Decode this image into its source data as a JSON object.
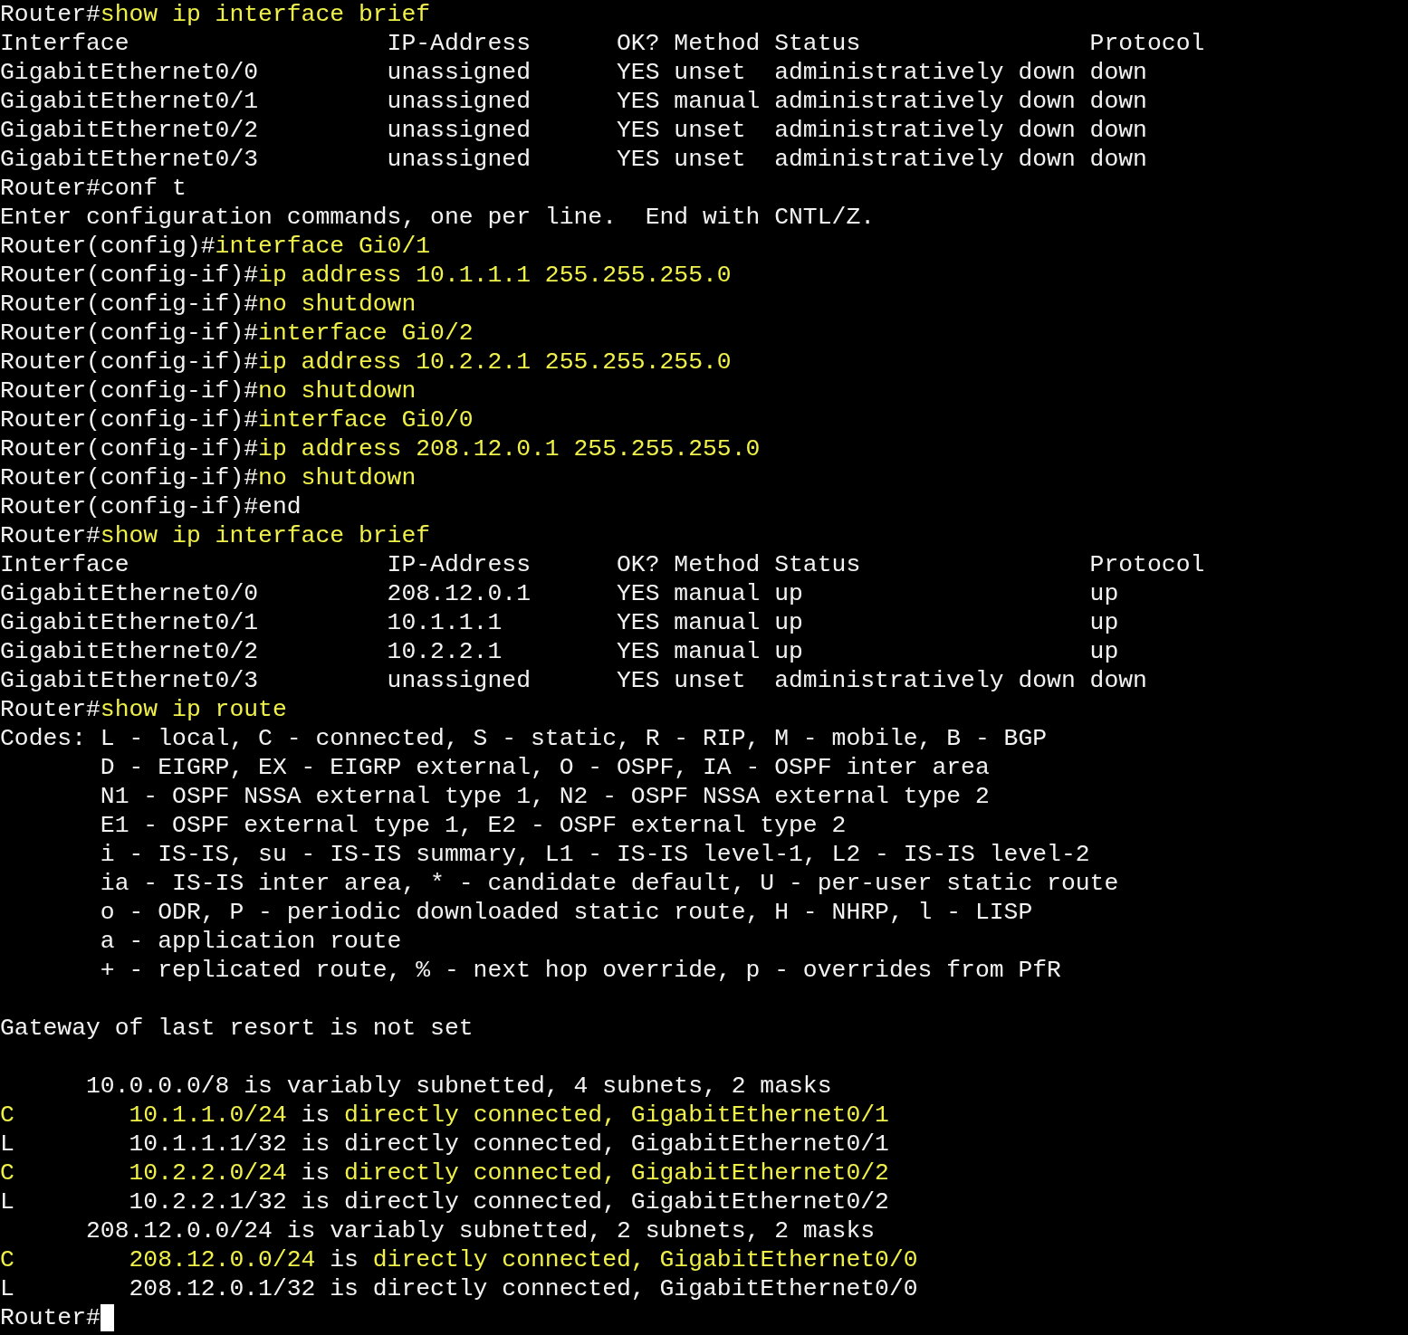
{
  "terminal": {
    "lines": [
      {
        "segments": [
          {
            "text": "Router#",
            "kind": "plain"
          },
          {
            "text": "show ip interface brief",
            "kind": "input"
          }
        ]
      },
      {
        "segments": [
          {
            "text": "Interface                  IP-Address      OK? Method Status                Protocol",
            "kind": "plain"
          }
        ]
      },
      {
        "segments": [
          {
            "text": "GigabitEthernet0/0         unassigned      YES unset  administratively down down",
            "kind": "plain"
          }
        ]
      },
      {
        "segments": [
          {
            "text": "GigabitEthernet0/1         unassigned      YES manual administratively down down",
            "kind": "plain"
          }
        ]
      },
      {
        "segments": [
          {
            "text": "GigabitEthernet0/2         unassigned      YES unset  administratively down down",
            "kind": "plain"
          }
        ]
      },
      {
        "segments": [
          {
            "text": "GigabitEthernet0/3         unassigned      YES unset  administratively down down",
            "kind": "plain"
          }
        ]
      },
      {
        "segments": [
          {
            "text": "Router#conf t",
            "kind": "plain"
          }
        ]
      },
      {
        "segments": [
          {
            "text": "Enter configuration commands, one per line.  End with CNTL/Z.",
            "kind": "plain"
          }
        ]
      },
      {
        "segments": [
          {
            "text": "Router(config)#",
            "kind": "plain"
          },
          {
            "text": "interface Gi0/1",
            "kind": "input"
          }
        ]
      },
      {
        "segments": [
          {
            "text": "Router(config-if)#",
            "kind": "plain"
          },
          {
            "text": "ip address 10.1.1.1 255.255.255.0",
            "kind": "input"
          }
        ]
      },
      {
        "segments": [
          {
            "text": "Router(config-if)#",
            "kind": "plain"
          },
          {
            "text": "no shutdown",
            "kind": "input"
          }
        ]
      },
      {
        "segments": [
          {
            "text": "Router(config-if)#",
            "kind": "plain"
          },
          {
            "text": "interface Gi0/2",
            "kind": "input"
          }
        ]
      },
      {
        "segments": [
          {
            "text": "Router(config-if)#",
            "kind": "plain"
          },
          {
            "text": "ip address 10.2.2.1 255.255.255.0",
            "kind": "input"
          }
        ]
      },
      {
        "segments": [
          {
            "text": "Router(config-if)#",
            "kind": "plain"
          },
          {
            "text": "no shutdown",
            "kind": "input"
          }
        ]
      },
      {
        "segments": [
          {
            "text": "Router(config-if)#",
            "kind": "plain"
          },
          {
            "text": "interface Gi0/0",
            "kind": "input"
          }
        ]
      },
      {
        "segments": [
          {
            "text": "Router(config-if)#",
            "kind": "plain"
          },
          {
            "text": "ip address 208.12.0.1 255.255.255.0",
            "kind": "input"
          }
        ]
      },
      {
        "segments": [
          {
            "text": "Router(config-if)#",
            "kind": "plain"
          },
          {
            "text": "no shutdown",
            "kind": "input"
          }
        ]
      },
      {
        "segments": [
          {
            "text": "Router(config-if)#end",
            "kind": "plain"
          }
        ]
      },
      {
        "segments": [
          {
            "text": "Router#",
            "kind": "plain"
          },
          {
            "text": "show ip interface brief",
            "kind": "input"
          }
        ]
      },
      {
        "segments": [
          {
            "text": "Interface                  IP-Address      OK? Method Status                Protocol",
            "kind": "plain"
          }
        ]
      },
      {
        "segments": [
          {
            "text": "GigabitEthernet0/0         208.12.0.1      YES manual up                    up",
            "kind": "plain"
          }
        ]
      },
      {
        "segments": [
          {
            "text": "GigabitEthernet0/1         10.1.1.1        YES manual up                    up",
            "kind": "plain"
          }
        ]
      },
      {
        "segments": [
          {
            "text": "GigabitEthernet0/2         10.2.2.1        YES manual up                    up",
            "kind": "plain"
          }
        ]
      },
      {
        "segments": [
          {
            "text": "GigabitEthernet0/3         unassigned      YES unset  administratively down down",
            "kind": "plain"
          }
        ]
      },
      {
        "segments": [
          {
            "text": "Router#",
            "kind": "plain"
          },
          {
            "text": "show ip route",
            "kind": "input"
          }
        ]
      },
      {
        "segments": [
          {
            "text": "Codes: L - local, C - connected, S - static, R - RIP, M - mobile, B - BGP",
            "kind": "plain"
          }
        ]
      },
      {
        "segments": [
          {
            "text": "       D - EIGRP, EX - EIGRP external, O - OSPF, IA - OSPF inter area",
            "kind": "plain"
          }
        ]
      },
      {
        "segments": [
          {
            "text": "       N1 - OSPF NSSA external type 1, N2 - OSPF NSSA external type 2",
            "kind": "plain"
          }
        ]
      },
      {
        "segments": [
          {
            "text": "       E1 - OSPF external type 1, E2 - OSPF external type 2",
            "kind": "plain"
          }
        ]
      },
      {
        "segments": [
          {
            "text": "       i - IS-IS, su - IS-IS summary, L1 - IS-IS level-1, L2 - IS-IS level-2",
            "kind": "plain"
          }
        ]
      },
      {
        "segments": [
          {
            "text": "       ia - IS-IS inter area, * - candidate default, U - per-user static route",
            "kind": "plain"
          }
        ]
      },
      {
        "segments": [
          {
            "text": "       o - ODR, P - periodic downloaded static route, H - NHRP, l - LISP",
            "kind": "plain"
          }
        ]
      },
      {
        "segments": [
          {
            "text": "       a - application route",
            "kind": "plain"
          }
        ]
      },
      {
        "segments": [
          {
            "text": "       + - replicated route, % - next hop override, p - overrides from PfR",
            "kind": "plain"
          }
        ],
        "blank_line_after": true
      },
      {
        "segments": [
          {
            "text": "Gateway of last resort is not set",
            "kind": "plain"
          }
        ],
        "blank_line_after": true
      },
      {
        "segments": [
          {
            "text": "      10.0.0.0/8 is variably subnetted, 4 subnets, 2 masks",
            "kind": "plain"
          }
        ]
      },
      {
        "segments": [
          {
            "text": "C        10.1.1.0/24",
            "kind": "input"
          },
          {
            "text": " is ",
            "kind": "plain"
          },
          {
            "text": "directly connected, GigabitEthernet0/1",
            "kind": "input"
          }
        ]
      },
      {
        "segments": [
          {
            "text": "L        10.1.1.1/32 is directly connected, GigabitEthernet0/1",
            "kind": "plain"
          }
        ]
      },
      {
        "segments": [
          {
            "text": "C        10.2.2.0/24",
            "kind": "input"
          },
          {
            "text": " is ",
            "kind": "plain"
          },
          {
            "text": "directly connected, GigabitEthernet0/2",
            "kind": "input"
          }
        ]
      },
      {
        "segments": [
          {
            "text": "L        10.2.2.1/32 is directly connected, GigabitEthernet0/2",
            "kind": "plain"
          }
        ]
      },
      {
        "segments": [
          {
            "text": "      208.12.0.0/24 is variably subnetted, 2 subnets, 2 masks",
            "kind": "plain"
          }
        ]
      },
      {
        "segments": [
          {
            "text": "C        208.12.0.0/24",
            "kind": "input"
          },
          {
            "text": " is ",
            "kind": "plain"
          },
          {
            "text": "directly connected, GigabitEthernet0/0",
            "kind": "input"
          }
        ]
      },
      {
        "segments": [
          {
            "text": "L        208.12.0.1/32 is directly connected, GigabitEthernet0/0",
            "kind": "plain"
          }
        ]
      },
      {
        "segments": [
          {
            "text": "Router#",
            "kind": "plain"
          }
        ],
        "cursor": true
      }
    ]
  }
}
